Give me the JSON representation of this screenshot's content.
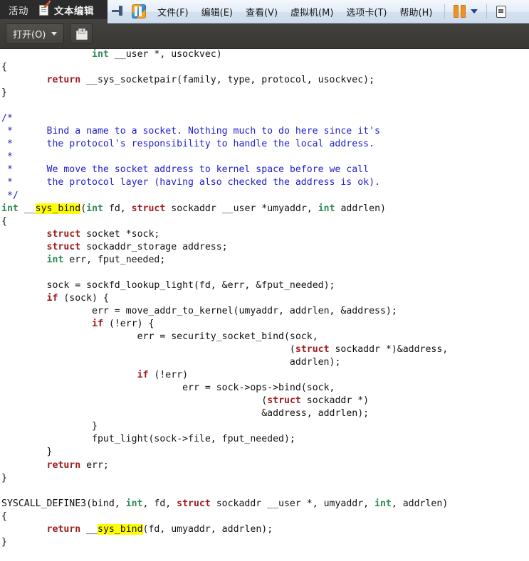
{
  "gnome_bar": {
    "activities_label": "活动",
    "app_icon": "text-editor-icon",
    "app_title": "文本编辑"
  },
  "vmware_bar": {
    "pin_icon": "pin-icon",
    "logo_icon": "vmware-logo-icon",
    "menus": [
      {
        "label": "文件(F)",
        "text": "文件",
        "mnemonic": "F"
      },
      {
        "label": "编辑(E)",
        "text": "编辑",
        "mnemonic": "E"
      },
      {
        "label": "查看(V)",
        "text": "查看",
        "mnemonic": "V"
      },
      {
        "label": "虚拟机(M)",
        "text": "虚拟机",
        "mnemonic": "M"
      },
      {
        "label": "选项卡(T)",
        "text": "选项卡",
        "mnemonic": "T"
      },
      {
        "label": "帮助(H)",
        "text": "帮助",
        "mnemonic": "H"
      }
    ],
    "pause_button": "pause-icon",
    "dropdown_caret": "chevron-down-icon",
    "edge_icon": "unity-mode-icon",
    "accent_orange": "#f0921e",
    "accent_blue": "#1b3fa0"
  },
  "app_toolbar": {
    "open_button": {
      "text": "打开",
      "mnemonic": "O",
      "label": "打开(O)"
    },
    "save_button_icon": "save-icon"
  },
  "editor": {
    "background": "#ffffff",
    "foreground": "#121212",
    "comment_color": "#2222cc",
    "type_keyword_color": "#2e8b57",
    "keyword_color": "#a11c1c",
    "search_highlight_color": "#ffff00",
    "search_term": "sys_bind",
    "lines": [
      {
        "indent": "                ",
        "parts": [
          {
            "t": "int",
            "c": "k-type"
          },
          {
            "t": " __user *, usockvec)",
            "c": ""
          }
        ]
      },
      {
        "indent": "",
        "parts": [
          {
            "t": "{",
            "c": ""
          }
        ]
      },
      {
        "indent": "        ",
        "parts": [
          {
            "t": "return",
            "c": "k-struct"
          },
          {
            "t": " __sys_socketpair(family, type, protocol, usockvec);",
            "c": ""
          }
        ]
      },
      {
        "indent": "",
        "parts": [
          {
            "t": "}",
            "c": ""
          }
        ]
      },
      {
        "indent": "",
        "parts": []
      },
      {
        "indent": "",
        "parts": [
          {
            "t": "/*",
            "c": "comment"
          }
        ]
      },
      {
        "indent": "",
        "parts": [
          {
            "t": " *      Bind a name to a socket. Nothing much to do here since it's",
            "c": "comment"
          }
        ]
      },
      {
        "indent": "",
        "parts": [
          {
            "t": " *      the protocol's responsibility to handle the local address.",
            "c": "comment"
          }
        ]
      },
      {
        "indent": "",
        "parts": [
          {
            "t": " *",
            "c": "comment"
          }
        ]
      },
      {
        "indent": "",
        "parts": [
          {
            "t": " *      We move the socket address to kernel space before we call",
            "c": "comment"
          }
        ]
      },
      {
        "indent": "",
        "parts": [
          {
            "t": " *      the protocol layer (having also checked the address is ok).",
            "c": "comment"
          }
        ]
      },
      {
        "indent": "",
        "parts": [
          {
            "t": " */",
            "c": "comment"
          }
        ]
      },
      {
        "indent": "",
        "parts": [
          {
            "t": "int",
            "c": "k-type"
          },
          {
            "t": " __",
            "c": ""
          },
          {
            "t": "sys_bind",
            "c": "hl"
          },
          {
            "t": "(",
            "c": ""
          },
          {
            "t": "int",
            "c": "k-type"
          },
          {
            "t": " fd, ",
            "c": ""
          },
          {
            "t": "struct",
            "c": "k-struct"
          },
          {
            "t": " sockaddr __user *umyaddr, ",
            "c": ""
          },
          {
            "t": "int",
            "c": "k-type"
          },
          {
            "t": " addrlen)",
            "c": ""
          }
        ]
      },
      {
        "indent": "",
        "parts": [
          {
            "t": "{",
            "c": ""
          }
        ]
      },
      {
        "indent": "        ",
        "parts": [
          {
            "t": "struct",
            "c": "k-struct"
          },
          {
            "t": " socket *sock;",
            "c": ""
          }
        ]
      },
      {
        "indent": "        ",
        "parts": [
          {
            "t": "struct",
            "c": "k-struct"
          },
          {
            "t": " sockaddr_storage address;",
            "c": ""
          }
        ]
      },
      {
        "indent": "        ",
        "parts": [
          {
            "t": "int",
            "c": "k-type"
          },
          {
            "t": " err, fput_needed;",
            "c": ""
          }
        ]
      },
      {
        "indent": "",
        "parts": []
      },
      {
        "indent": "        ",
        "parts": [
          {
            "t": "sock = sockfd_lookup_light(fd, &err, &fput_needed);",
            "c": ""
          }
        ]
      },
      {
        "indent": "        ",
        "parts": [
          {
            "t": "if",
            "c": "k-struct"
          },
          {
            "t": " (sock) {",
            "c": ""
          }
        ]
      },
      {
        "indent": "                ",
        "parts": [
          {
            "t": "err = move_addr_to_kernel(umyaddr, addrlen, &address);",
            "c": ""
          }
        ]
      },
      {
        "indent": "                ",
        "parts": [
          {
            "t": "if",
            "c": "k-struct"
          },
          {
            "t": " (!err) {",
            "c": ""
          }
        ]
      },
      {
        "indent": "                        ",
        "parts": [
          {
            "t": "err = security_socket_bind(sock,",
            "c": ""
          }
        ]
      },
      {
        "indent": "                                                   ",
        "parts": [
          {
            "t": "(",
            "c": ""
          },
          {
            "t": "struct",
            "c": "k-struct"
          },
          {
            "t": " sockaddr *)&address,",
            "c": ""
          }
        ]
      },
      {
        "indent": "                                                   ",
        "parts": [
          {
            "t": "addrlen);",
            "c": ""
          }
        ]
      },
      {
        "indent": "                        ",
        "parts": [
          {
            "t": "if",
            "c": "k-struct"
          },
          {
            "t": " (!err)",
            "c": ""
          }
        ]
      },
      {
        "indent": "                                ",
        "parts": [
          {
            "t": "err = sock->ops->bind(sock,",
            "c": ""
          }
        ]
      },
      {
        "indent": "                                              ",
        "parts": [
          {
            "t": "(",
            "c": ""
          },
          {
            "t": "struct",
            "c": "k-struct"
          },
          {
            "t": " sockaddr *)",
            "c": ""
          }
        ]
      },
      {
        "indent": "                                              ",
        "parts": [
          {
            "t": "&address, addrlen);",
            "c": ""
          }
        ]
      },
      {
        "indent": "                ",
        "parts": [
          {
            "t": "}",
            "c": ""
          }
        ]
      },
      {
        "indent": "                ",
        "parts": [
          {
            "t": "fput_light(sock->file, fput_needed);",
            "c": ""
          }
        ]
      },
      {
        "indent": "        ",
        "parts": [
          {
            "t": "}",
            "c": ""
          }
        ]
      },
      {
        "indent": "        ",
        "parts": [
          {
            "t": "return",
            "c": "k-struct"
          },
          {
            "t": " err;",
            "c": ""
          }
        ]
      },
      {
        "indent": "",
        "parts": [
          {
            "t": "}",
            "c": ""
          }
        ]
      },
      {
        "indent": "",
        "parts": []
      },
      {
        "indent": "",
        "parts": [
          {
            "t": "SYSCALL_DEFINE3(bind, ",
            "c": ""
          },
          {
            "t": "int",
            "c": "k-type"
          },
          {
            "t": ", fd, ",
            "c": ""
          },
          {
            "t": "struct",
            "c": "k-struct"
          },
          {
            "t": " sockaddr __user *, umyaddr, ",
            "c": ""
          },
          {
            "t": "int",
            "c": "k-type"
          },
          {
            "t": ", addrlen)",
            "c": ""
          }
        ]
      },
      {
        "indent": "",
        "parts": [
          {
            "t": "{",
            "c": ""
          }
        ]
      },
      {
        "indent": "        ",
        "parts": [
          {
            "t": "return",
            "c": "k-struct"
          },
          {
            "t": " __",
            "c": ""
          },
          {
            "t": "sys_bind",
            "c": "hl"
          },
          {
            "t": "(fd, umyaddr, addrlen);",
            "c": ""
          }
        ]
      },
      {
        "indent": "",
        "parts": [
          {
            "t": "}",
            "c": ""
          }
        ]
      }
    ]
  }
}
